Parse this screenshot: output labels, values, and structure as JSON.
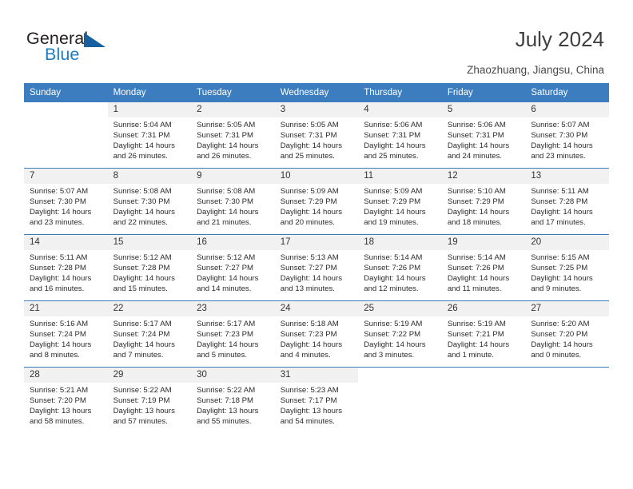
{
  "brand": {
    "name_part1": "General",
    "name_part2": "Blue",
    "triangle_color": "#18619e",
    "blue_color": "#1c7cc0"
  },
  "header": {
    "title": "July 2024",
    "location": "Zhaozhuang, Jiangsu, China"
  },
  "theme": {
    "header_blue": "#3b7dbf",
    "daynum_band": "#f1f1f1",
    "text": "#2b2b2b"
  },
  "weekday_headers": [
    "Sunday",
    "Monday",
    "Tuesday",
    "Wednesday",
    "Thursday",
    "Friday",
    "Saturday"
  ],
  "weeks": [
    [
      {
        "day": "",
        "sunrise": "",
        "sunset": "",
        "daylight_line1": "",
        "daylight_line2": ""
      },
      {
        "day": "1",
        "sunrise": "Sunrise: 5:04 AM",
        "sunset": "Sunset: 7:31 PM",
        "daylight_line1": "Daylight: 14 hours",
        "daylight_line2": "and 26 minutes."
      },
      {
        "day": "2",
        "sunrise": "Sunrise: 5:05 AM",
        "sunset": "Sunset: 7:31 PM",
        "daylight_line1": "Daylight: 14 hours",
        "daylight_line2": "and 26 minutes."
      },
      {
        "day": "3",
        "sunrise": "Sunrise: 5:05 AM",
        "sunset": "Sunset: 7:31 PM",
        "daylight_line1": "Daylight: 14 hours",
        "daylight_line2": "and 25 minutes."
      },
      {
        "day": "4",
        "sunrise": "Sunrise: 5:06 AM",
        "sunset": "Sunset: 7:31 PM",
        "daylight_line1": "Daylight: 14 hours",
        "daylight_line2": "and 25 minutes."
      },
      {
        "day": "5",
        "sunrise": "Sunrise: 5:06 AM",
        "sunset": "Sunset: 7:31 PM",
        "daylight_line1": "Daylight: 14 hours",
        "daylight_line2": "and 24 minutes."
      },
      {
        "day": "6",
        "sunrise": "Sunrise: 5:07 AM",
        "sunset": "Sunset: 7:30 PM",
        "daylight_line1": "Daylight: 14 hours",
        "daylight_line2": "and 23 minutes."
      }
    ],
    [
      {
        "day": "7",
        "sunrise": "Sunrise: 5:07 AM",
        "sunset": "Sunset: 7:30 PM",
        "daylight_line1": "Daylight: 14 hours",
        "daylight_line2": "and 23 minutes."
      },
      {
        "day": "8",
        "sunrise": "Sunrise: 5:08 AM",
        "sunset": "Sunset: 7:30 PM",
        "daylight_line1": "Daylight: 14 hours",
        "daylight_line2": "and 22 minutes."
      },
      {
        "day": "9",
        "sunrise": "Sunrise: 5:08 AM",
        "sunset": "Sunset: 7:30 PM",
        "daylight_line1": "Daylight: 14 hours",
        "daylight_line2": "and 21 minutes."
      },
      {
        "day": "10",
        "sunrise": "Sunrise: 5:09 AM",
        "sunset": "Sunset: 7:29 PM",
        "daylight_line1": "Daylight: 14 hours",
        "daylight_line2": "and 20 minutes."
      },
      {
        "day": "11",
        "sunrise": "Sunrise: 5:09 AM",
        "sunset": "Sunset: 7:29 PM",
        "daylight_line1": "Daylight: 14 hours",
        "daylight_line2": "and 19 minutes."
      },
      {
        "day": "12",
        "sunrise": "Sunrise: 5:10 AM",
        "sunset": "Sunset: 7:29 PM",
        "daylight_line1": "Daylight: 14 hours",
        "daylight_line2": "and 18 minutes."
      },
      {
        "day": "13",
        "sunrise": "Sunrise: 5:11 AM",
        "sunset": "Sunset: 7:28 PM",
        "daylight_line1": "Daylight: 14 hours",
        "daylight_line2": "and 17 minutes."
      }
    ],
    [
      {
        "day": "14",
        "sunrise": "Sunrise: 5:11 AM",
        "sunset": "Sunset: 7:28 PM",
        "daylight_line1": "Daylight: 14 hours",
        "daylight_line2": "and 16 minutes."
      },
      {
        "day": "15",
        "sunrise": "Sunrise: 5:12 AM",
        "sunset": "Sunset: 7:28 PM",
        "daylight_line1": "Daylight: 14 hours",
        "daylight_line2": "and 15 minutes."
      },
      {
        "day": "16",
        "sunrise": "Sunrise: 5:12 AM",
        "sunset": "Sunset: 7:27 PM",
        "daylight_line1": "Daylight: 14 hours",
        "daylight_line2": "and 14 minutes."
      },
      {
        "day": "17",
        "sunrise": "Sunrise: 5:13 AM",
        "sunset": "Sunset: 7:27 PM",
        "daylight_line1": "Daylight: 14 hours",
        "daylight_line2": "and 13 minutes."
      },
      {
        "day": "18",
        "sunrise": "Sunrise: 5:14 AM",
        "sunset": "Sunset: 7:26 PM",
        "daylight_line1": "Daylight: 14 hours",
        "daylight_line2": "and 12 minutes."
      },
      {
        "day": "19",
        "sunrise": "Sunrise: 5:14 AM",
        "sunset": "Sunset: 7:26 PM",
        "daylight_line1": "Daylight: 14 hours",
        "daylight_line2": "and 11 minutes."
      },
      {
        "day": "20",
        "sunrise": "Sunrise: 5:15 AM",
        "sunset": "Sunset: 7:25 PM",
        "daylight_line1": "Daylight: 14 hours",
        "daylight_line2": "and 9 minutes."
      }
    ],
    [
      {
        "day": "21",
        "sunrise": "Sunrise: 5:16 AM",
        "sunset": "Sunset: 7:24 PM",
        "daylight_line1": "Daylight: 14 hours",
        "daylight_line2": "and 8 minutes."
      },
      {
        "day": "22",
        "sunrise": "Sunrise: 5:17 AM",
        "sunset": "Sunset: 7:24 PM",
        "daylight_line1": "Daylight: 14 hours",
        "daylight_line2": "and 7 minutes."
      },
      {
        "day": "23",
        "sunrise": "Sunrise: 5:17 AM",
        "sunset": "Sunset: 7:23 PM",
        "daylight_line1": "Daylight: 14 hours",
        "daylight_line2": "and 5 minutes."
      },
      {
        "day": "24",
        "sunrise": "Sunrise: 5:18 AM",
        "sunset": "Sunset: 7:23 PM",
        "daylight_line1": "Daylight: 14 hours",
        "daylight_line2": "and 4 minutes."
      },
      {
        "day": "25",
        "sunrise": "Sunrise: 5:19 AM",
        "sunset": "Sunset: 7:22 PM",
        "daylight_line1": "Daylight: 14 hours",
        "daylight_line2": "and 3 minutes."
      },
      {
        "day": "26",
        "sunrise": "Sunrise: 5:19 AM",
        "sunset": "Sunset: 7:21 PM",
        "daylight_line1": "Daylight: 14 hours",
        "daylight_line2": "and 1 minute."
      },
      {
        "day": "27",
        "sunrise": "Sunrise: 5:20 AM",
        "sunset": "Sunset: 7:20 PM",
        "daylight_line1": "Daylight: 14 hours",
        "daylight_line2": "and 0 minutes."
      }
    ],
    [
      {
        "day": "28",
        "sunrise": "Sunrise: 5:21 AM",
        "sunset": "Sunset: 7:20 PM",
        "daylight_line1": "Daylight: 13 hours",
        "daylight_line2": "and 58 minutes."
      },
      {
        "day": "29",
        "sunrise": "Sunrise: 5:22 AM",
        "sunset": "Sunset: 7:19 PM",
        "daylight_line1": "Daylight: 13 hours",
        "daylight_line2": "and 57 minutes."
      },
      {
        "day": "30",
        "sunrise": "Sunrise: 5:22 AM",
        "sunset": "Sunset: 7:18 PM",
        "daylight_line1": "Daylight: 13 hours",
        "daylight_line2": "and 55 minutes."
      },
      {
        "day": "31",
        "sunrise": "Sunrise: 5:23 AM",
        "sunset": "Sunset: 7:17 PM",
        "daylight_line1": "Daylight: 13 hours",
        "daylight_line2": "and 54 minutes."
      },
      {
        "day": "",
        "sunrise": "",
        "sunset": "",
        "daylight_line1": "",
        "daylight_line2": ""
      },
      {
        "day": "",
        "sunrise": "",
        "sunset": "",
        "daylight_line1": "",
        "daylight_line2": ""
      },
      {
        "day": "",
        "sunrise": "",
        "sunset": "",
        "daylight_line1": "",
        "daylight_line2": ""
      }
    ]
  ]
}
